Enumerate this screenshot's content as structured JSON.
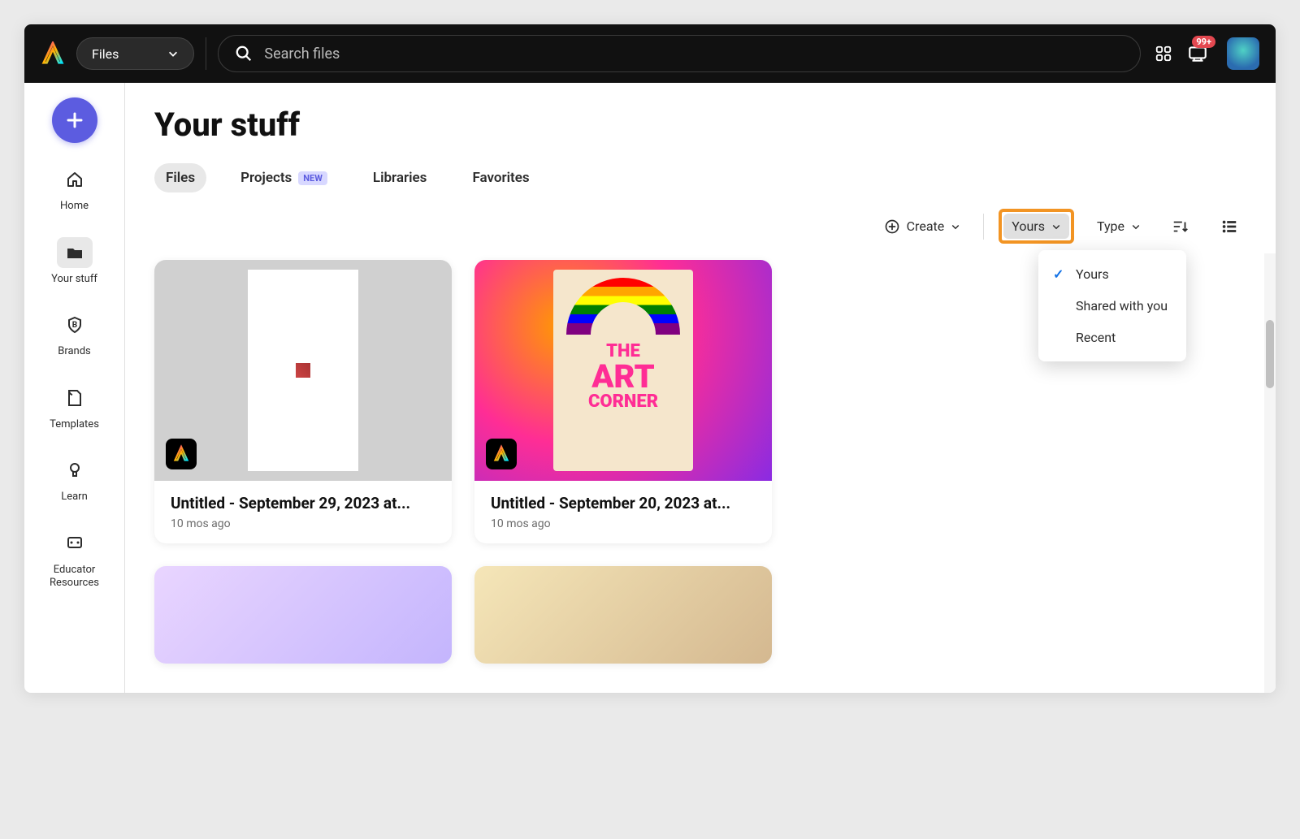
{
  "topbar": {
    "files_dropdown": "Files",
    "search_placeholder": "Search files",
    "notif_badge": "99+"
  },
  "sidebar": {
    "create_label": "+",
    "items": [
      {
        "label": "Home"
      },
      {
        "label": "Your stuff"
      },
      {
        "label": "Brands"
      },
      {
        "label": "Templates"
      },
      {
        "label": "Learn"
      },
      {
        "label": "Educator Resources"
      }
    ]
  },
  "page": {
    "title": "Your stuff",
    "tabs": [
      {
        "label": "Files",
        "active": true
      },
      {
        "label": "Projects",
        "badge": "NEW"
      },
      {
        "label": "Libraries"
      },
      {
        "label": "Favorites"
      }
    ],
    "toolbar": {
      "create": "Create",
      "filter_ownership": "Yours",
      "filter_type": "Type"
    },
    "dropdown": {
      "opt1": "Yours",
      "opt2": "Shared with you",
      "opt3": "Recent"
    },
    "cards": [
      {
        "title": "Untitled - September 29, 2023 at...",
        "meta": "10 mos ago"
      },
      {
        "title": "Untitled - September 20, 2023 at...",
        "meta": "10 mos ago"
      }
    ],
    "poster": {
      "line1": "THE",
      "line2": "ART",
      "line3": "CORNER"
    }
  }
}
